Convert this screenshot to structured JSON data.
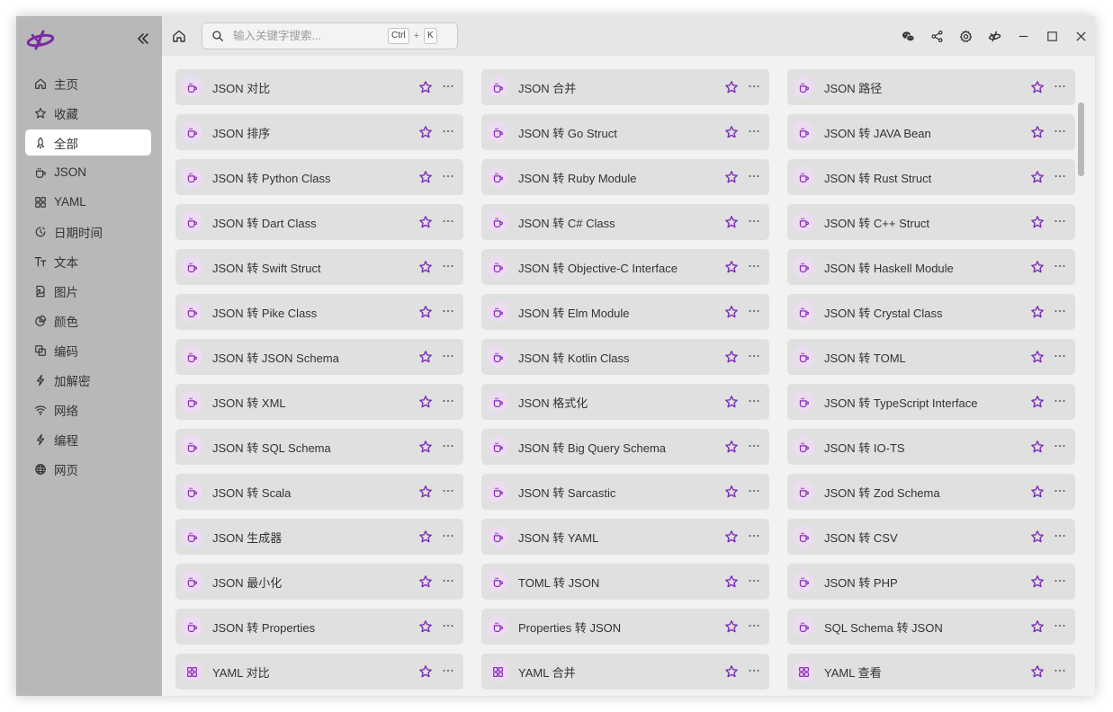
{
  "sidebar": {
    "items": [
      {
        "label": "主页",
        "icon": "home-icon",
        "active": false
      },
      {
        "label": "收藏",
        "icon": "star-icon",
        "active": false
      },
      {
        "label": "全部",
        "icon": "rocket-icon",
        "active": true
      },
      {
        "label": "JSON",
        "icon": "cup-icon",
        "active": false
      },
      {
        "label": "YAML",
        "icon": "grid-icon",
        "active": false
      },
      {
        "label": "日期时间",
        "icon": "clock-icon",
        "active": false
      },
      {
        "label": "文本",
        "icon": "text-icon",
        "active": false
      },
      {
        "label": "图片",
        "icon": "image-icon",
        "active": false
      },
      {
        "label": "颜色",
        "icon": "pie-icon",
        "active": false
      },
      {
        "label": "编码",
        "icon": "copy-icon",
        "active": false
      },
      {
        "label": "加解密",
        "icon": "bolt-icon",
        "active": false
      },
      {
        "label": "网络",
        "icon": "wifi-icon",
        "active": false
      },
      {
        "label": "编程",
        "icon": "bolt-icon",
        "active": false
      },
      {
        "label": "网页",
        "icon": "globe-icon",
        "active": false
      }
    ]
  },
  "search": {
    "placeholder": "输入关键字搜索...",
    "value": "",
    "shortcut_key1": "Ctrl",
    "shortcut_plus": "+",
    "shortcut_key2": "K"
  },
  "colors": {
    "accent": "#8a2bb8",
    "sidebar_bg": "#b8b8b8",
    "card_bg": "#e0e0e0"
  },
  "tools": [
    {
      "label": "JSON 对比",
      "icon": "cup-icon"
    },
    {
      "label": "JSON 合并",
      "icon": "cup-icon"
    },
    {
      "label": "JSON 路径",
      "icon": "cup-icon"
    },
    {
      "label": "JSON 排序",
      "icon": "cup-icon"
    },
    {
      "label": "JSON 转 Go Struct",
      "icon": "cup-icon"
    },
    {
      "label": "JSON 转 JAVA Bean",
      "icon": "cup-icon"
    },
    {
      "label": "JSON 转 Python Class",
      "icon": "cup-icon"
    },
    {
      "label": "JSON 转 Ruby Module",
      "icon": "cup-icon"
    },
    {
      "label": "JSON 转 Rust Struct",
      "icon": "cup-icon"
    },
    {
      "label": "JSON 转 Dart Class",
      "icon": "cup-icon"
    },
    {
      "label": "JSON 转 C# Class",
      "icon": "cup-icon"
    },
    {
      "label": "JSON 转 C++ Struct",
      "icon": "cup-icon"
    },
    {
      "label": "JSON 转 Swift Struct",
      "icon": "cup-icon"
    },
    {
      "label": "JSON 转 Objective-C Interface",
      "icon": "cup-icon"
    },
    {
      "label": "JSON 转 Haskell Module",
      "icon": "cup-icon"
    },
    {
      "label": "JSON 转 Pike Class",
      "icon": "cup-icon"
    },
    {
      "label": "JSON 转 Elm Module",
      "icon": "cup-icon"
    },
    {
      "label": "JSON 转 Crystal Class",
      "icon": "cup-icon"
    },
    {
      "label": "JSON 转 JSON Schema",
      "icon": "cup-icon"
    },
    {
      "label": "JSON 转 Kotlin Class",
      "icon": "cup-icon"
    },
    {
      "label": "JSON 转 TOML",
      "icon": "cup-icon"
    },
    {
      "label": "JSON 转 XML",
      "icon": "cup-icon"
    },
    {
      "label": "JSON 格式化",
      "icon": "cup-icon"
    },
    {
      "label": "JSON 转 TypeScript Interface",
      "icon": "cup-icon"
    },
    {
      "label": "JSON 转 SQL Schema",
      "icon": "cup-icon"
    },
    {
      "label": "JSON 转 Big Query Schema",
      "icon": "cup-icon"
    },
    {
      "label": "JSON 转 IO-TS",
      "icon": "cup-icon"
    },
    {
      "label": "JSON 转 Scala",
      "icon": "cup-icon"
    },
    {
      "label": "JSON 转 Sarcastic",
      "icon": "cup-icon"
    },
    {
      "label": "JSON 转 Zod Schema",
      "icon": "cup-icon"
    },
    {
      "label": "JSON 生成器",
      "icon": "cup-icon"
    },
    {
      "label": "JSON 转 YAML",
      "icon": "cup-icon"
    },
    {
      "label": "JSON 转 CSV",
      "icon": "cup-icon"
    },
    {
      "label": "JSON 最小化",
      "icon": "cup-icon"
    },
    {
      "label": "TOML 转 JSON",
      "icon": "cup-icon"
    },
    {
      "label": "JSON 转 PHP",
      "icon": "cup-icon"
    },
    {
      "label": "JSON 转 Properties",
      "icon": "cup-icon"
    },
    {
      "label": "Properties 转 JSON",
      "icon": "cup-icon"
    },
    {
      "label": "SQL Schema 转 JSON",
      "icon": "cup-icon"
    },
    {
      "label": "YAML 对比",
      "icon": "grid-icon"
    },
    {
      "label": "YAML 合并",
      "icon": "grid-icon"
    },
    {
      "label": "YAML 查看",
      "icon": "grid-icon"
    }
  ]
}
